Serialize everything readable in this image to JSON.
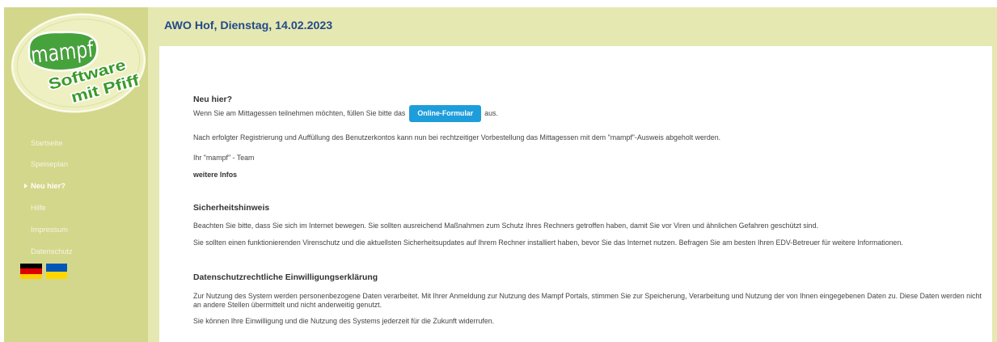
{
  "theme": {
    "sidebar": "#d3d78b",
    "frame": "#e5e8b1",
    "title": "#24498a",
    "accent": "#1e9ddb",
    "text": "#444444",
    "logo_green": "#3b9a2b"
  },
  "logo": {
    "badge": "mampf",
    "line1": "Software",
    "line2": "mit Pfiff"
  },
  "nav": {
    "items": [
      {
        "label": "Startseite",
        "active": false
      },
      {
        "label": "Speiseplan",
        "active": false
      },
      {
        "label": "Neu hier?",
        "active": true
      },
      {
        "label": "Hilfe",
        "active": false
      },
      {
        "label": "Impressum",
        "active": false
      },
      {
        "label": "Datenschutz",
        "active": false
      }
    ]
  },
  "flags": [
    {
      "icon": "flag-de-icon",
      "stripes": [
        "#000000",
        "#dd0000",
        "#ffce00"
      ]
    },
    {
      "icon": "flag-ua-icon",
      "stripes": [
        "#0057b7",
        "#ffd700"
      ]
    }
  ],
  "header": {
    "title": "AWO Hof, Dienstag, 14.02.2023"
  },
  "intro": {
    "heading": "Neu hier?",
    "text_before_button": "Wenn Sie am Mittagessen teilnehmen möchten, füllen Sie bitte das",
    "button_label": "Online-Formular",
    "text_after_button": "aus.",
    "registration_note": "Nach erfolgter Registrierung und Auffüllung des Benutzerkontos kann nun bei rechtzeitiger Vorbestellung das Mittagessen mit dem \"mampf\"-Ausweis abgeholt werden.",
    "signature": "Ihr \"mampf\" - Team",
    "more_link": "weitere Infos"
  },
  "security": {
    "heading": "Sicherheitshinweis",
    "p1": "Beachten Sie bitte, dass Sie sich im Internet bewegen. Sie sollten ausreichend Maßnahmen zum Schutz Ihres Rechners getroffen haben, damit Sie vor Viren und ähnlichen Gefahren geschützt sind.",
    "p2": "Sie sollten einen funktionierenden Virenschutz und die aktuellsten Sicherheitsupdates auf Ihrem Rechner installiert haben, bevor Sie das Internet nutzen. Befragen Sie am besten Ihren EDV-Betreuer für weitere Informationen."
  },
  "privacy": {
    "heading": "Datenschutzrechtliche Einwilligungserklärung",
    "p1_lines": [
      "Zur Nutzung des System werden personenbezogene Daten verarbeitet. Mit Ihrer Anmeldung zur Nutzung des Mampf Portals, stimmen Sie zur Speicherung, Verarbeitung und Nutzung der von Ihnen eingegebenen Daten zu. Diese Daten werden nicht",
      "an andere Stellen übermittelt und nicht anderweitig genutzt."
    ],
    "p2": "Sie können Ihre Einwilligung und die Nutzung des Systems jederzeit für die Zukunft widerrufen."
  }
}
